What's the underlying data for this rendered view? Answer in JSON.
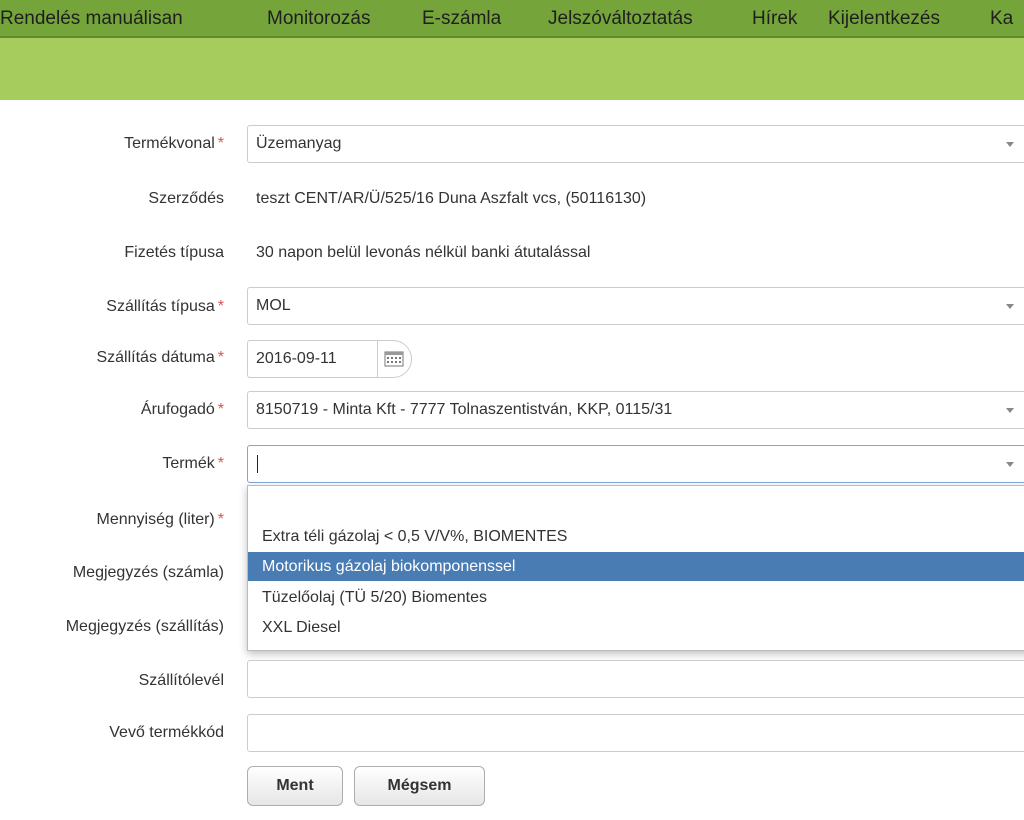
{
  "nav": {
    "items": [
      "Rendelés manuálisan",
      "Monitorozás",
      "E-számla",
      "Jelszóváltoztatás",
      "Hírek",
      "Kijelentkezés",
      "Ka"
    ]
  },
  "form": {
    "product_line": {
      "label": "Termékvonal",
      "value": "Üzemanyag"
    },
    "contract": {
      "label": "Szerződés",
      "value": "teszt CENT/AR/Ü/525/16 Duna Aszfalt vcs, (50116130)"
    },
    "payment_type": {
      "label": "Fizetés típusa",
      "value": "30 napon belül levonás nélkül banki átutalással"
    },
    "delivery_type": {
      "label": "Szállítás típusa",
      "value": "MOL"
    },
    "delivery_date": {
      "label": "Szállítás dátuma",
      "value": "2016-09-11"
    },
    "consignee": {
      "label": "Árufogadó",
      "value": "8150719 - Minta Kft - 7777 Tolnaszentistván, KKP, 0115/31"
    },
    "product": {
      "label": "Termék",
      "value": "",
      "options": [
        "Extra téli gázolaj < 0,5 V/V%, BIOMENTES",
        "Motorikus gázolaj biokomponenssel",
        "Tüzelőolaj (TÜ 5/20) Biomentes",
        "XXL Diesel"
      ],
      "highlighted_option": "Motorikus gázolaj biokomponenssel"
    },
    "quantity": {
      "label": "Mennyiség (liter)"
    },
    "note_invoice": {
      "label": "Megjegyzés (számla)"
    },
    "note_delivery": {
      "label": "Megjegyzés (szállítás)"
    },
    "delivery_note": {
      "label": "Szállítólevél"
    },
    "buyer_product_code": {
      "label": "Vevő termékkód"
    },
    "required_marker": "*"
  },
  "buttons": {
    "save": "Ment",
    "cancel": "Mégsem"
  },
  "colors": {
    "nav_bg": "#74a43a",
    "subbar_bg": "#a6cc5e",
    "highlight": "#4a7cb4",
    "required": "#d9534f"
  }
}
